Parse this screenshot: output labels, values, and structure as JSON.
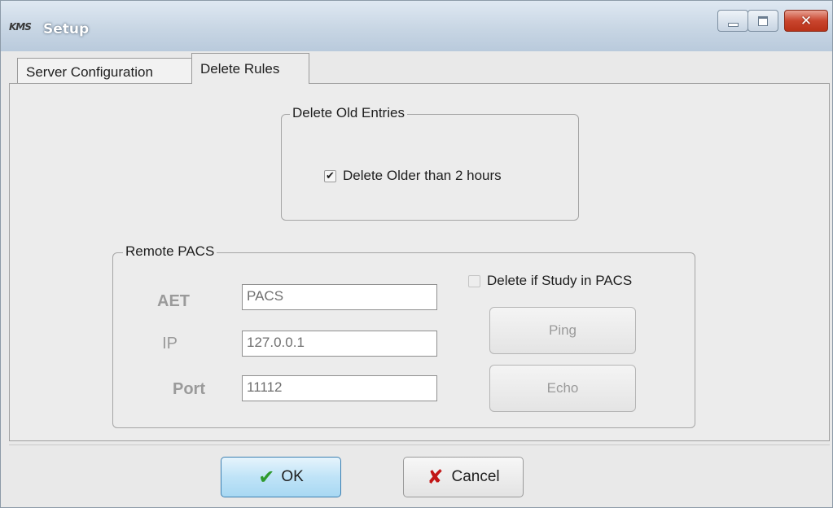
{
  "window": {
    "logo_text": "KMS",
    "title": "Setup",
    "minimize_glyph": "",
    "close_glyph": "✕"
  },
  "tabs": [
    {
      "label": "Server Configuration",
      "active": false
    },
    {
      "label": "Delete Rules",
      "active": true
    }
  ],
  "delete_old": {
    "group_title": "Delete Old Entries",
    "checkbox_label": "Delete Older than 2 hours",
    "checked": true,
    "check_glyph": "✔"
  },
  "remote_pacs": {
    "group_title": "Remote PACS",
    "aet_label": "AET",
    "aet_value": "PACS",
    "ip_label": "IP",
    "ip_value": "127.0.0.1",
    "port_label": "Port",
    "port_value": "11112",
    "delete_if_label": "Delete if Study in PACS",
    "delete_if_checked": false,
    "ping_label": "Ping",
    "echo_label": "Echo"
  },
  "dialog_buttons": {
    "ok_icon": "✔",
    "ok_label": "OK",
    "cancel_icon": "✘",
    "cancel_label": "Cancel"
  }
}
